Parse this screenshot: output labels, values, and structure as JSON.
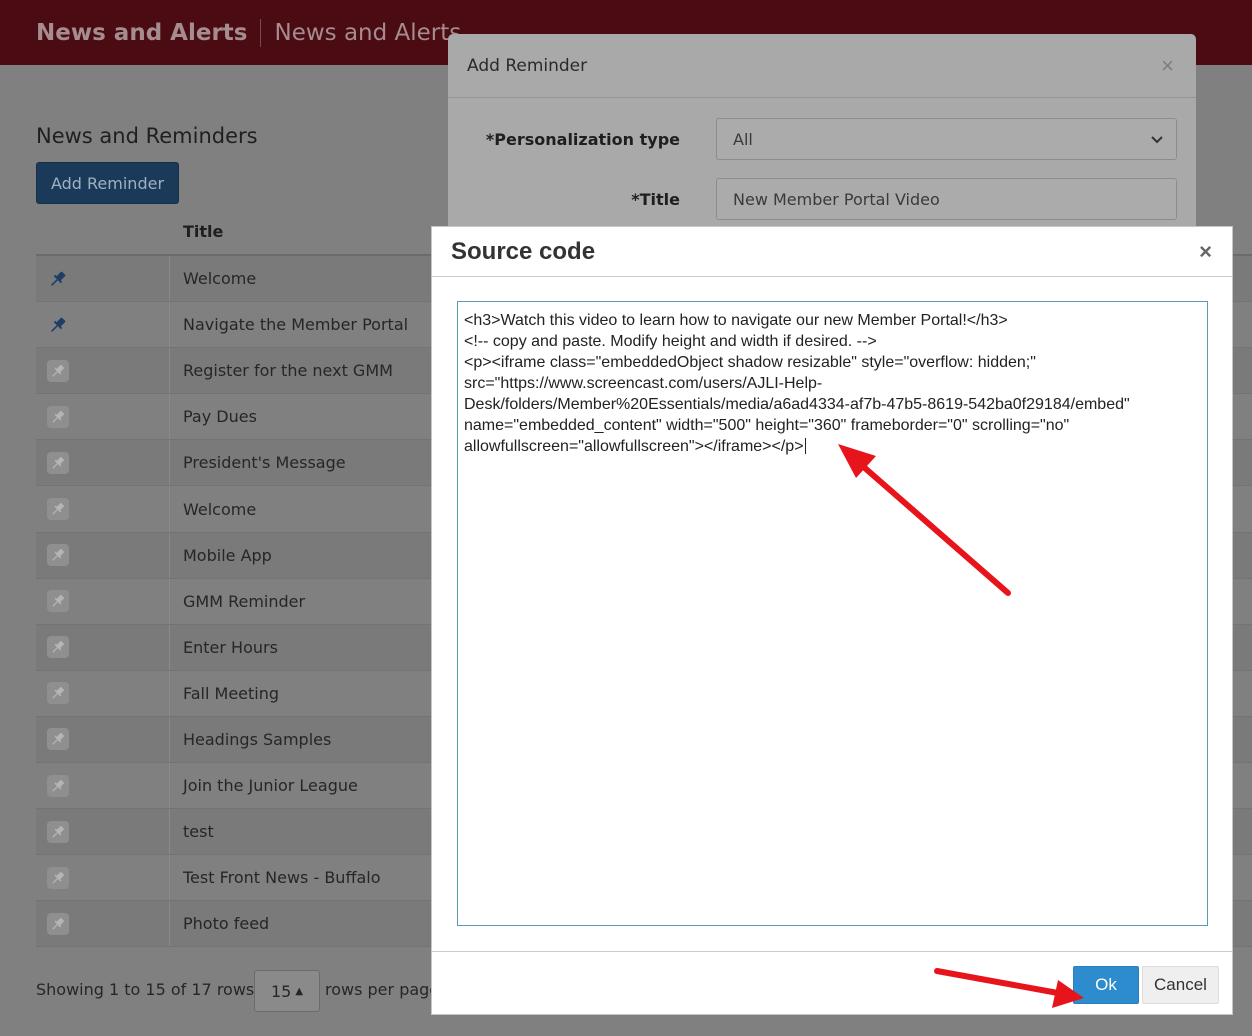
{
  "header": {
    "brand": "News and Alerts",
    "subtitle": "News and Alerts"
  },
  "page": {
    "title": "News and Reminders",
    "add_button": "Add Reminder",
    "table": {
      "column_title": "Title",
      "rows": [
        {
          "title": "Welcome",
          "pinned": true
        },
        {
          "title": "Navigate the Member Portal",
          "pinned": true
        },
        {
          "title": "Register for the next GMM",
          "pinned": false
        },
        {
          "title": "Pay Dues",
          "pinned": false
        },
        {
          "title": "President's Message",
          "pinned": false
        },
        {
          "title": "Welcome",
          "pinned": false
        },
        {
          "title": "Mobile App",
          "pinned": false
        },
        {
          "title": "GMM Reminder",
          "pinned": false
        },
        {
          "title": "Enter Hours",
          "pinned": false
        },
        {
          "title": "Fall Meeting",
          "pinned": false
        },
        {
          "title": "Headings Samples",
          "pinned": false
        },
        {
          "title": "Join the Junior League",
          "pinned": false
        },
        {
          "title": "test",
          "pinned": false
        },
        {
          "title": "Test Front News - Buffalo",
          "pinned": false
        },
        {
          "title": "Photo feed",
          "pinned": false
        }
      ]
    },
    "footer": {
      "showing": "Showing 1 to 15 of 17 rows",
      "per_page_value": "15",
      "per_page_label": "rows per page"
    }
  },
  "add_modal": {
    "title": "Add Reminder",
    "close": "×",
    "personalization_label": "*Personalization type",
    "personalization_value": "All",
    "title_label": "*Title",
    "title_value": "New Member Portal Video"
  },
  "source_modal": {
    "title": "Source code",
    "close": "×",
    "lines": [
      "<h3>Watch this video to learn how to navigate our new Member Portal!</h3>",
      "<!-- copy and paste. Modify height and width if desired. -->",
      "<p><iframe class=\"embeddedObject shadow resizable\" style=\"overflow: hidden;\"",
      "src=\"https://www.screencast.com/users/AJLI-Help-",
      "Desk/folders/Member%20Essentials/media/a6ad4334-af7b-47b5-8619-542ba0f29184/embed\"",
      "name=\"embedded_content\" width=\"500\" height=\"360\" frameborder=\"0\" scrolling=\"no\"",
      "allowfullscreen=\"allowfullscreen\"></iframe></p>"
    ],
    "ok_label": "Ok",
    "cancel_label": "Cancel"
  },
  "colors": {
    "header": "#8b1a24",
    "primary_button": "#2d8ccd",
    "annotation": "#e8141b"
  }
}
